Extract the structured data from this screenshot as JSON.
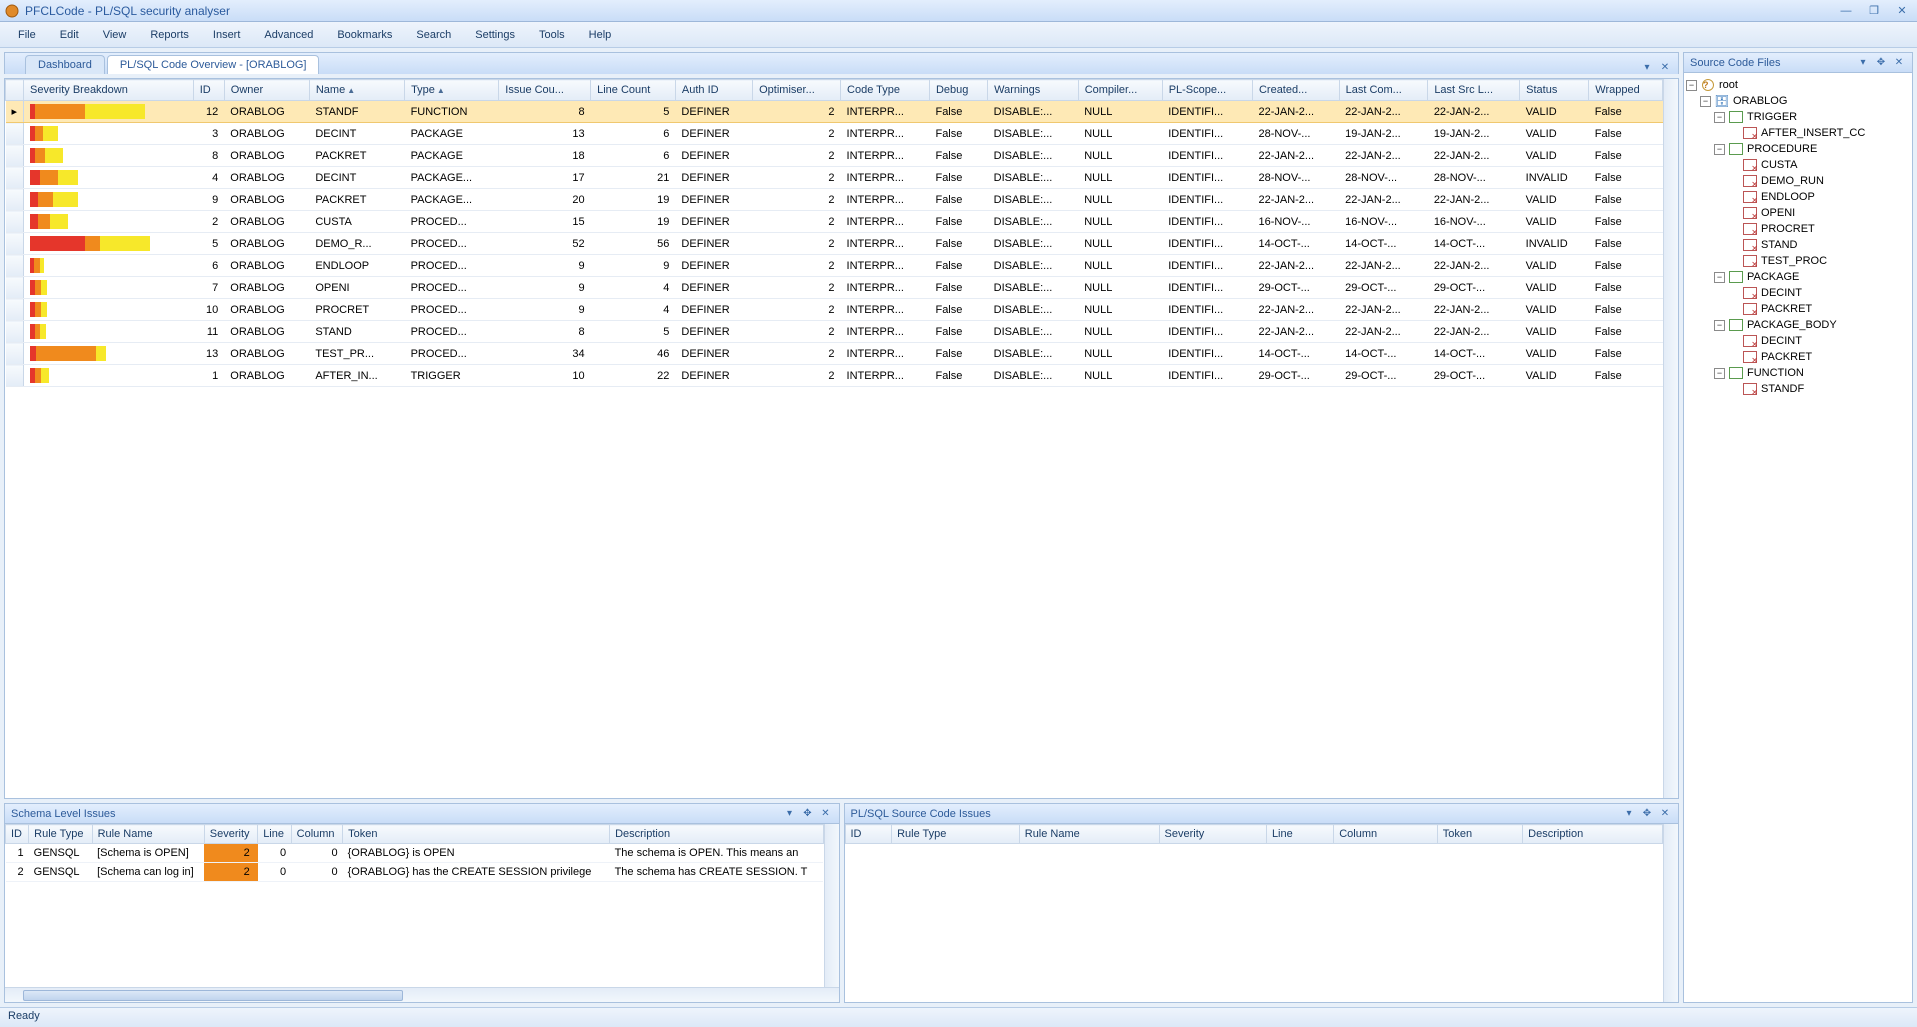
{
  "window": {
    "title": "PFCLCode - PL/SQL security analyser"
  },
  "menu": [
    "File",
    "Edit",
    "View",
    "Reports",
    "Insert",
    "Advanced",
    "Bookmarks",
    "Search",
    "Settings",
    "Tools",
    "Help"
  ],
  "tabs": [
    {
      "label": "Dashboard",
      "active": false
    },
    {
      "label": "PL/SQL Code Overview - [ORABLOG]",
      "active": true
    }
  ],
  "grid": {
    "columns": [
      "Severity Breakdown",
      "ID",
      "Owner",
      "Name",
      "Type",
      "Issue Cou...",
      "Line Count",
      "Auth ID",
      "Optimiser...",
      "Code Type",
      "Debug",
      "Warnings",
      "Compiler...",
      "PL-Scope...",
      "Created...",
      "Last Com...",
      "Last Src L...",
      "Status",
      "Wrapped"
    ],
    "rows": [
      {
        "sev": [
          5,
          50,
          60
        ],
        "id": 12,
        "owner": "ORABLOG",
        "name": "STANDF",
        "type": "FUNCTION",
        "issues": 8,
        "lines": 5,
        "auth": "DEFINER",
        "opt": 2,
        "code": "INTERPR...",
        "debug": "False",
        "warn": "DISABLE:...",
        "comp": "NULL",
        "scope": "IDENTIFI...",
        "created": "22-JAN-2...",
        "lastcom": "22-JAN-2...",
        "lastsrc": "22-JAN-2...",
        "status": "VALID",
        "wrapped": "False",
        "selected": true
      },
      {
        "sev": [
          5,
          8,
          15
        ],
        "id": 3,
        "owner": "ORABLOG",
        "name": "DECINT",
        "type": "PACKAGE",
        "issues": 13,
        "lines": 6,
        "auth": "DEFINER",
        "opt": 2,
        "code": "INTERPR...",
        "debug": "False",
        "warn": "DISABLE:...",
        "comp": "NULL",
        "scope": "IDENTIFI...",
        "created": "28-NOV-...",
        "lastcom": "19-JAN-2...",
        "lastsrc": "19-JAN-2...",
        "status": "VALID",
        "wrapped": "False"
      },
      {
        "sev": [
          5,
          10,
          18
        ],
        "id": 8,
        "owner": "ORABLOG",
        "name": "PACKRET",
        "type": "PACKAGE",
        "issues": 18,
        "lines": 6,
        "auth": "DEFINER",
        "opt": 2,
        "code": "INTERPR...",
        "debug": "False",
        "warn": "DISABLE:...",
        "comp": "NULL",
        "scope": "IDENTIFI...",
        "created": "22-JAN-2...",
        "lastcom": "22-JAN-2...",
        "lastsrc": "22-JAN-2...",
        "status": "VALID",
        "wrapped": "False"
      },
      {
        "sev": [
          10,
          18,
          20
        ],
        "id": 4,
        "owner": "ORABLOG",
        "name": "DECINT",
        "type": "PACKAGE...",
        "issues": 17,
        "lines": 21,
        "auth": "DEFINER",
        "opt": 2,
        "code": "INTERPR...",
        "debug": "False",
        "warn": "DISABLE:...",
        "comp": "NULL",
        "scope": "IDENTIFI...",
        "created": "28-NOV-...",
        "lastcom": "28-NOV-...",
        "lastsrc": "28-NOV-...",
        "status": "INVALID",
        "wrapped": "False"
      },
      {
        "sev": [
          8,
          15,
          25
        ],
        "id": 9,
        "owner": "ORABLOG",
        "name": "PACKRET",
        "type": "PACKAGE...",
        "issues": 20,
        "lines": 19,
        "auth": "DEFINER",
        "opt": 2,
        "code": "INTERPR...",
        "debug": "False",
        "warn": "DISABLE:...",
        "comp": "NULL",
        "scope": "IDENTIFI...",
        "created": "22-JAN-2...",
        "lastcom": "22-JAN-2...",
        "lastsrc": "22-JAN-2...",
        "status": "VALID",
        "wrapped": "False"
      },
      {
        "sev": [
          8,
          12,
          18
        ],
        "id": 2,
        "owner": "ORABLOG",
        "name": "CUSTA",
        "type": "PROCED...",
        "issues": 15,
        "lines": 19,
        "auth": "DEFINER",
        "opt": 2,
        "code": "INTERPR...",
        "debug": "False",
        "warn": "DISABLE:...",
        "comp": "NULL",
        "scope": "IDENTIFI...",
        "created": "16-NOV-...",
        "lastcom": "16-NOV-...",
        "lastsrc": "16-NOV-...",
        "status": "VALID",
        "wrapped": "False"
      },
      {
        "sev": [
          55,
          15,
          50
        ],
        "id": 5,
        "owner": "ORABLOG",
        "name": "DEMO_R...",
        "type": "PROCED...",
        "issues": 52,
        "lines": 56,
        "auth": "DEFINER",
        "opt": 2,
        "code": "INTERPR...",
        "debug": "False",
        "warn": "DISABLE:...",
        "comp": "NULL",
        "scope": "IDENTIFI...",
        "created": "14-OCT-...",
        "lastcom": "14-OCT-...",
        "lastsrc": "14-OCT-...",
        "status": "INVALID",
        "wrapped": "False"
      },
      {
        "sev": [
          4,
          6,
          4
        ],
        "id": 6,
        "owner": "ORABLOG",
        "name": "ENDLOOP",
        "type": "PROCED...",
        "issues": 9,
        "lines": 9,
        "auth": "DEFINER",
        "opt": 2,
        "code": "INTERPR...",
        "debug": "False",
        "warn": "DISABLE:...",
        "comp": "NULL",
        "scope": "IDENTIFI...",
        "created": "22-JAN-2...",
        "lastcom": "22-JAN-2...",
        "lastsrc": "22-JAN-2...",
        "status": "VALID",
        "wrapped": "False"
      },
      {
        "sev": [
          5,
          6,
          6
        ],
        "id": 7,
        "owner": "ORABLOG",
        "name": "OPENI",
        "type": "PROCED...",
        "issues": 9,
        "lines": 4,
        "auth": "DEFINER",
        "opt": 2,
        "code": "INTERPR...",
        "debug": "False",
        "warn": "DISABLE:...",
        "comp": "NULL",
        "scope": "IDENTIFI...",
        "created": "29-OCT-...",
        "lastcom": "29-OCT-...",
        "lastsrc": "29-OCT-...",
        "status": "VALID",
        "wrapped": "False"
      },
      {
        "sev": [
          5,
          6,
          6
        ],
        "id": 10,
        "owner": "ORABLOG",
        "name": "PROCRET",
        "type": "PROCED...",
        "issues": 9,
        "lines": 4,
        "auth": "DEFINER",
        "opt": 2,
        "code": "INTERPR...",
        "debug": "False",
        "warn": "DISABLE:...",
        "comp": "NULL",
        "scope": "IDENTIFI...",
        "created": "22-JAN-2...",
        "lastcom": "22-JAN-2...",
        "lastsrc": "22-JAN-2...",
        "status": "VALID",
        "wrapped": "False"
      },
      {
        "sev": [
          5,
          5,
          6
        ],
        "id": 11,
        "owner": "ORABLOG",
        "name": "STAND",
        "type": "PROCED...",
        "issues": 8,
        "lines": 5,
        "auth": "DEFINER",
        "opt": 2,
        "code": "INTERPR...",
        "debug": "False",
        "warn": "DISABLE:...",
        "comp": "NULL",
        "scope": "IDENTIFI...",
        "created": "22-JAN-2...",
        "lastcom": "22-JAN-2...",
        "lastsrc": "22-JAN-2...",
        "status": "VALID",
        "wrapped": "False"
      },
      {
        "sev": [
          6,
          60,
          10
        ],
        "id": 13,
        "owner": "ORABLOG",
        "name": "TEST_PR...",
        "type": "PROCED...",
        "issues": 34,
        "lines": 46,
        "auth": "DEFINER",
        "opt": 2,
        "code": "INTERPR...",
        "debug": "False",
        "warn": "DISABLE:...",
        "comp": "NULL",
        "scope": "IDENTIFI...",
        "created": "14-OCT-...",
        "lastcom": "14-OCT-...",
        "lastsrc": "14-OCT-...",
        "status": "VALID",
        "wrapped": "False"
      },
      {
        "sev": [
          5,
          6,
          8
        ],
        "id": 1,
        "owner": "ORABLOG",
        "name": "AFTER_IN...",
        "type": "TRIGGER",
        "issues": 10,
        "lines": 22,
        "auth": "DEFINER",
        "opt": 2,
        "code": "INTERPR...",
        "debug": "False",
        "warn": "DISABLE:...",
        "comp": "NULL",
        "scope": "IDENTIFI...",
        "created": "29-OCT-...",
        "lastcom": "29-OCT-...",
        "lastsrc": "29-OCT-...",
        "status": "VALID",
        "wrapped": "False"
      }
    ]
  },
  "schema_issues": {
    "title": "Schema Level Issues",
    "columns": [
      "ID",
      "Rule Type",
      "Rule Name",
      "Severity",
      "Line",
      "Column",
      "Token",
      "Description"
    ],
    "rows": [
      {
        "id": 1,
        "rtype": "GENSQL",
        "rname": "[Schema is OPEN]",
        "sev": 2,
        "line": 0,
        "col": 0,
        "token": "{ORABLOG} is OPEN",
        "desc": "The schema is OPEN. This means an"
      },
      {
        "id": 2,
        "rtype": "GENSQL",
        "rname": "[Schema can log in]",
        "sev": 2,
        "line": 0,
        "col": 0,
        "token": "{ORABLOG} has the CREATE SESSION privilege",
        "desc": "The schema has CREATE SESSION. T"
      }
    ]
  },
  "code_issues": {
    "title": "PL/SQL Source Code Issues",
    "columns": [
      "ID",
      "Rule Type",
      "Rule Name",
      "Severity",
      "Line",
      "Column",
      "Token",
      "Description"
    ]
  },
  "tree": {
    "title": "Source Code Files",
    "root": "root",
    "schema": "ORABLOG",
    "groups": [
      {
        "name": "TRIGGER",
        "items": [
          "AFTER_INSERT_CC"
        ]
      },
      {
        "name": "PROCEDURE",
        "items": [
          "CUSTA",
          "DEMO_RUN",
          "ENDLOOP",
          "OPENI",
          "PROCRET",
          "STAND",
          "TEST_PROC"
        ]
      },
      {
        "name": "PACKAGE",
        "items": [
          "DECINT",
          "PACKRET"
        ]
      },
      {
        "name": "PACKAGE_BODY",
        "items": [
          "DECINT",
          "PACKRET"
        ]
      },
      {
        "name": "FUNCTION",
        "items": [
          "STANDF"
        ]
      }
    ]
  },
  "statusbar": {
    "text": "Ready"
  }
}
